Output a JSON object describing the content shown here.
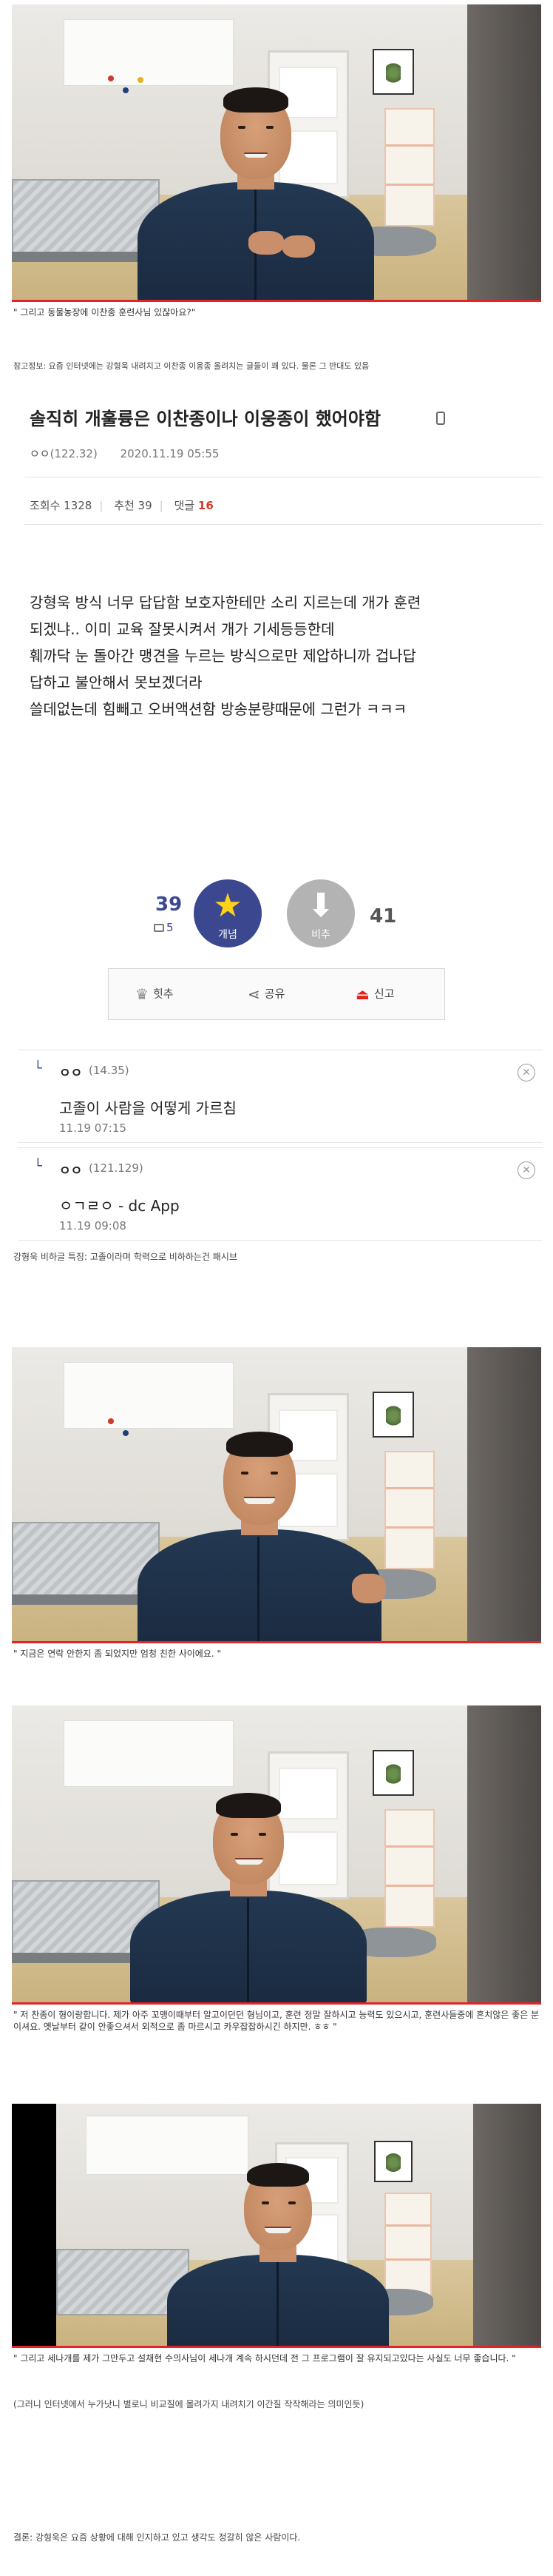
{
  "videos": [
    {
      "caption": "\" 그리고 동물농장에 이찬종 훈련사님 있잖아요?\""
    },
    {
      "caption": "\" 지금은 연락 안한지 좀 되었지만 엄청 친한 사이에요. \""
    },
    {
      "caption": "\" 저 찬종이 형이랑합니다. 제가 아주 꼬맹이때부터 알고이던던 형님이고, 훈련 정말 잘하시고 능력도 있으시고, 훈련사들중에 흔치않은 좋은 분이셔요. 옛날부터 같이 안좋으셔서 외적으로 좀 마르시고 카우잡잡하시긴 하지만. ㅎㅎ \""
    },
    {
      "caption": "\" 그리고 세나개를 제가 그만두고 설채현 수의사님이 세나개 계속 하시던데 전 그 프로그램이 잘 유지되고있다는 사실도 너무 좋습니다. \""
    }
  ],
  "ref_info": "참고정보: 요즘 인터넷에는 강형욱 내려치고 이찬종 이웅종 올려치는 글들이 꽤 있다. 물론 그 반대도 있음",
  "post": {
    "title": "솔직히 개훌륭은 이찬종이나 이웅종이 했어야함",
    "author": "ㅇㅇ",
    "author_ip": "(122.32)",
    "date": "2020.11.19 05:55",
    "views_label": "조회수 1328",
    "recommend_label": "추천 39",
    "comments_prefix": "댓글",
    "comments_count": "16",
    "body": [
      "강형욱 방식 너무 답답함 보호자한테만 소리 지르는데 개가 훈련",
      "되겠냐.. 이미 교육 잘못시켜서 개가 기세등등한데",
      "훼까닥 눈 돌아간 맹견을 누르는 방식으로만 제압하니까 겁나답",
      "답하고 불안해서 못보겠더라",
      "쓸데없는데 힘빼고 오버액션함 방송분량때문에 그런가 ㅋㅋㅋ"
    ]
  },
  "votes": {
    "up_count": "39",
    "up_fixed": "5",
    "up_label": "개념",
    "down_label": "비추",
    "down_count": "41"
  },
  "actions": {
    "hit": "힛추",
    "share": "공유",
    "report": "신고"
  },
  "comments": [
    {
      "nick": "ㅇㅇ",
      "ip": "(14.35)",
      "text": "고졸이 사람을 어떻게 가르침",
      "time": "11.19 07:15"
    },
    {
      "nick": "ㅇㅇ",
      "ip": "(121.129)",
      "text": "ㅇㄱㄹㅇ - dc App",
      "time": "11.19 09:08"
    }
  ],
  "note1": "강형욱 비하글 특징: 고졸이라며 학력으로 비하하는건 패시브",
  "note2": "(그러니 인터넷에서 누가낫니 별로니 비교질에 몰려가지 내려치기 이간질 작작해라는 의미인듯)",
  "conclusion": "결론: 강형욱은 요즘 상황에 대해 인지하고 있고 생각도 정갈히 않은 사람이다."
}
